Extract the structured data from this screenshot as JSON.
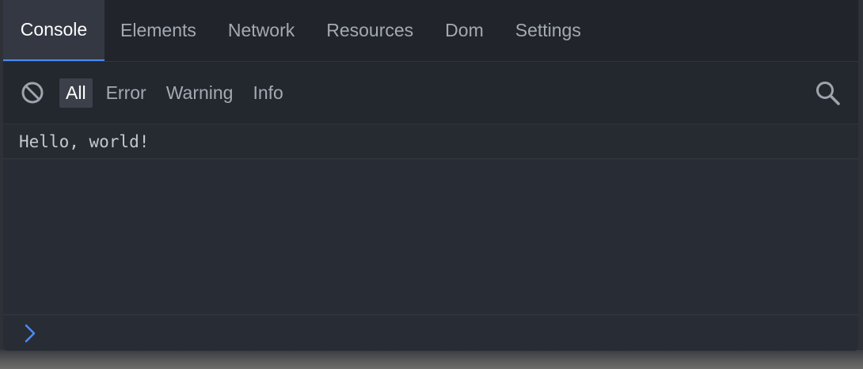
{
  "tabs": [
    {
      "label": "Console",
      "active": true
    },
    {
      "label": "Elements",
      "active": false
    },
    {
      "label": "Network",
      "active": false
    },
    {
      "label": "Resources",
      "active": false
    },
    {
      "label": "Dom",
      "active": false
    },
    {
      "label": "Settings",
      "active": false
    }
  ],
  "toolbar": {
    "clear_icon": "clear-console-icon",
    "filters": [
      {
        "label": "All",
        "selected": true
      },
      {
        "label": "Error",
        "selected": false
      },
      {
        "label": "Warning",
        "selected": false
      },
      {
        "label": "Info",
        "selected": false
      }
    ],
    "search_icon": "search-icon"
  },
  "logs": [
    {
      "text": "Hello, world!"
    }
  ],
  "prompt": {
    "icon": "chevron-right-icon",
    "value": "",
    "placeholder": ""
  },
  "colors": {
    "accent": "#4a8cf7",
    "panel_bg": "#282c34",
    "tabbar_bg": "#21252b",
    "text_muted": "#a4a9b3"
  }
}
